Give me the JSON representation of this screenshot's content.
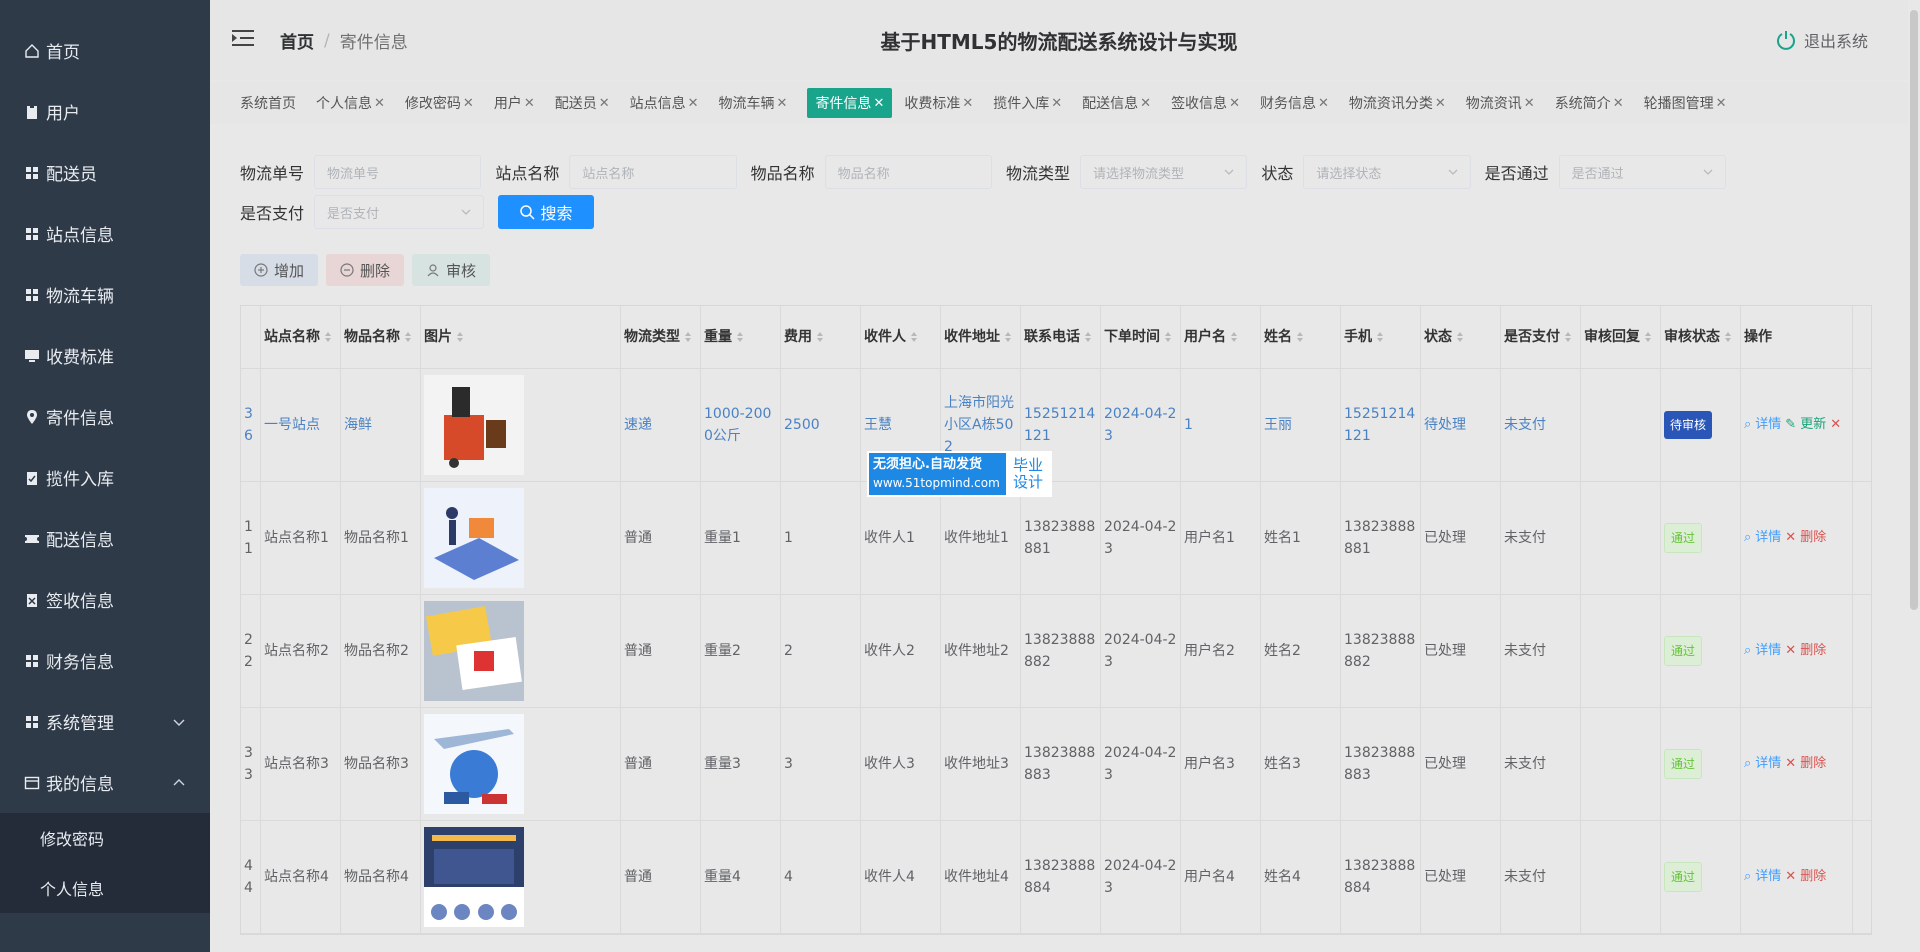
{
  "sidebar": {
    "items": [
      {
        "label": "首页",
        "icon": "home-icon"
      },
      {
        "label": "用户",
        "icon": "clipboard-icon"
      },
      {
        "label": "配送员",
        "icon": "grid-icon"
      },
      {
        "label": "站点信息",
        "icon": "grid-icon"
      },
      {
        "label": "物流车辆",
        "icon": "grid-icon"
      },
      {
        "label": "收费标准",
        "icon": "monitor-icon"
      },
      {
        "label": "寄件信息",
        "icon": "location-icon"
      },
      {
        "label": "揽件入库",
        "icon": "clipboard-check-icon"
      },
      {
        "label": "配送信息",
        "icon": "ticket-icon"
      },
      {
        "label": "签收信息",
        "icon": "clipboard-x-icon"
      },
      {
        "label": "财务信息",
        "icon": "grid-icon"
      },
      {
        "label": "系统管理",
        "icon": "grid-icon"
      },
      {
        "label": "我的信息",
        "icon": "window-icon"
      }
    ],
    "sub": [
      "修改密码",
      "个人信息"
    ]
  },
  "header": {
    "crumb_home": "首页",
    "crumb_sep": "/",
    "crumb_current": "寄件信息",
    "title": "基于HTML5的物流配送系统设计与实现",
    "logout": "退出系统"
  },
  "tabs": [
    {
      "label": "系统首页",
      "closable": false
    },
    {
      "label": "个人信息",
      "closable": true
    },
    {
      "label": "修改密码",
      "closable": true
    },
    {
      "label": "用户",
      "closable": true
    },
    {
      "label": "配送员",
      "closable": true
    },
    {
      "label": "站点信息",
      "closable": true
    },
    {
      "label": "物流车辆",
      "closable": true
    },
    {
      "label": "寄件信息",
      "closable": true,
      "active": true
    },
    {
      "label": "收费标准",
      "closable": true
    },
    {
      "label": "揽件入库",
      "closable": true
    },
    {
      "label": "配送信息",
      "closable": true
    },
    {
      "label": "签收信息",
      "closable": true
    },
    {
      "label": "财务信息",
      "closable": true
    },
    {
      "label": "物流资讯分类",
      "closable": true
    },
    {
      "label": "物流资讯",
      "closable": true
    },
    {
      "label": "系统简介",
      "closable": true
    },
    {
      "label": "轮播图管理",
      "closable": true
    }
  ],
  "filters": {
    "wuliudanhao": {
      "label": "物流单号",
      "placeholder": "物流单号"
    },
    "zhandian": {
      "label": "站点名称",
      "placeholder": "站点名称"
    },
    "wupin": {
      "label": "物品名称",
      "placeholder": "物品名称"
    },
    "leixing": {
      "label": "物流类型",
      "placeholder": "请选择物流类型"
    },
    "zhuangtai": {
      "label": "状态",
      "placeholder": "请选择状态"
    },
    "tongguo": {
      "label": "是否通过",
      "placeholder": "是否通过"
    },
    "zhifu": {
      "label": "是否支付",
      "placeholder": "是否支付"
    },
    "search_label": "搜索"
  },
  "actions": {
    "add": "增加",
    "delete": "删除",
    "audit": "审核"
  },
  "table": {
    "headers": [
      "",
      "站点名称",
      "物品名称",
      "图片",
      "物流类型",
      "重量",
      "费用",
      "收件人",
      "收件地址",
      "联系电话",
      "下单时间",
      "用户名",
      "姓名",
      "手机",
      "状态",
      "是否支付",
      "审核回复",
      "审核状态",
      "操作"
    ],
    "rows": [
      {
        "id": "36",
        "site": "一号站点",
        "item": "海鲜",
        "type": "速递",
        "weight": "1000-2000公斤",
        "fee": "2500",
        "recv": "王慧",
        "addr": "上海市阳光小区A栋502",
        "phone": "15251214121",
        "date": "2024-04-23",
        "user": "1",
        "name": "王丽",
        "mobile": "15251214121",
        "state": "待处理",
        "paid": "未支付",
        "reply": "",
        "audit": "待审核",
        "audit_kind": "wait",
        "ops": [
          "详情",
          "更新",
          "删除"
        ]
      },
      {
        "id": "11",
        "site": "站点名称1",
        "item": "物品名称1",
        "type": "普通",
        "weight": "重量1",
        "fee": "1",
        "recv": "收件人1",
        "addr": "收件地址1",
        "phone": "13823888881",
        "date": "2024-04-23",
        "user": "用户名1",
        "name": "姓名1",
        "mobile": "13823888881",
        "state": "已处理",
        "paid": "未支付",
        "reply": "",
        "audit": "通过",
        "audit_kind": "pass",
        "ops": [
          "详情",
          "删除"
        ]
      },
      {
        "id": "22",
        "site": "站点名称2",
        "item": "物品名称2",
        "type": "普通",
        "weight": "重量2",
        "fee": "2",
        "recv": "收件人2",
        "addr": "收件地址2",
        "phone": "13823888882",
        "date": "2024-04-23",
        "user": "用户名2",
        "name": "姓名2",
        "mobile": "13823888882",
        "state": "已处理",
        "paid": "未支付",
        "reply": "",
        "audit": "通过",
        "audit_kind": "pass",
        "ops": [
          "详情",
          "删除"
        ]
      },
      {
        "id": "33",
        "site": "站点名称3",
        "item": "物品名称3",
        "type": "普通",
        "weight": "重量3",
        "fee": "3",
        "recv": "收件人3",
        "addr": "收件地址3",
        "phone": "13823888883",
        "date": "2024-04-23",
        "user": "用户名3",
        "name": "姓名3",
        "mobile": "13823888883",
        "state": "已处理",
        "paid": "未支付",
        "reply": "",
        "audit": "通过",
        "audit_kind": "pass",
        "ops": [
          "详情",
          "删除"
        ]
      },
      {
        "id": "44",
        "site": "站点名称4",
        "item": "物品名称4",
        "type": "普通",
        "weight": "重量4",
        "fee": "4",
        "recv": "收件人4",
        "addr": "收件地址4",
        "phone": "13823888884",
        "date": "2024-04-23",
        "user": "用户名4",
        "name": "姓名4",
        "mobile": "13823888884",
        "state": "已处理",
        "paid": "未支付",
        "reply": "",
        "audit": "通过",
        "audit_kind": "pass",
        "ops": [
          "详情",
          "删除"
        ]
      }
    ]
  },
  "badge": {
    "line1": "无须担心.自动发货",
    "line2": "www.51topmind.com",
    "r1": "毕业",
    "r2": "设计"
  },
  "colors": {
    "sidebar": "#2f3a48",
    "accent": "#19a58b",
    "primary": "#1e90ff"
  }
}
